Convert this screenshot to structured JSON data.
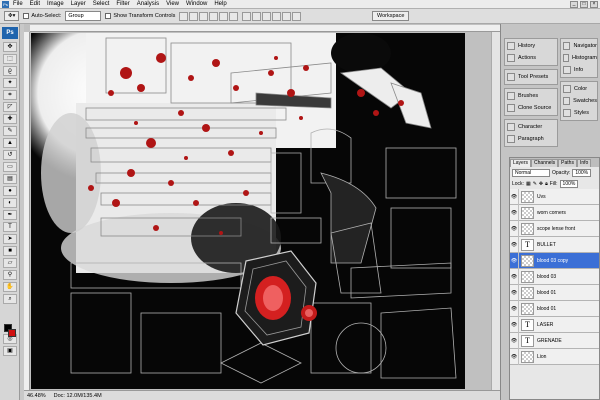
{
  "menubar": {
    "logo": "Ps",
    "items": [
      "File",
      "Edit",
      "Image",
      "Layer",
      "Select",
      "Filter",
      "Analysis",
      "View",
      "Window",
      "Help"
    ]
  },
  "options": {
    "auto_select_label": "Auto-Select:",
    "auto_select_value": "Group",
    "transform_label": "Show Transform Controls",
    "workspace_label": "Workspace"
  },
  "status": {
    "zoom": "46.48%",
    "doc": "Doc: 12.0M/135.4M"
  },
  "dock": {
    "history": "History",
    "actions": "Actions",
    "tool_presets": "Tool Presets",
    "brushes": "Brushes",
    "clone_source": "Clone Source",
    "character": "Character",
    "paragraph": "Paragraph",
    "navigator": "Navigator",
    "histogram": "Histogram",
    "info": "Info",
    "color": "Color",
    "swatches": "Swatches",
    "styles": "Styles"
  },
  "layers": {
    "tabs": [
      "Layers",
      "Channels",
      "Paths",
      "Info"
    ],
    "blend_mode": "Normal",
    "opacity_label": "Opacity:",
    "opacity_value": "100%",
    "lock_label": "Lock:",
    "fill_label": "Fill:",
    "fill_value": "100%",
    "rows": [
      {
        "name": "Uvs",
        "type": "pixel",
        "selected": false
      },
      {
        "name": "worn corners",
        "type": "pixel",
        "selected": false
      },
      {
        "name": "scope lense front",
        "type": "pixel",
        "selected": false
      },
      {
        "name": "BULLET",
        "type": "text",
        "selected": false
      },
      {
        "name": "blood 03 copy",
        "type": "pixel",
        "selected": true
      },
      {
        "name": "blood 03",
        "type": "pixel",
        "selected": false
      },
      {
        "name": "blood 01",
        "type": "pixel",
        "selected": false
      },
      {
        "name": "blood 01",
        "type": "pixel",
        "selected": false
      },
      {
        "name": "LASER",
        "type": "text",
        "selected": false
      },
      {
        "name": "GRENADE",
        "type": "text",
        "selected": false
      },
      {
        "name": "Lion",
        "type": "pixel",
        "selected": false
      }
    ]
  }
}
